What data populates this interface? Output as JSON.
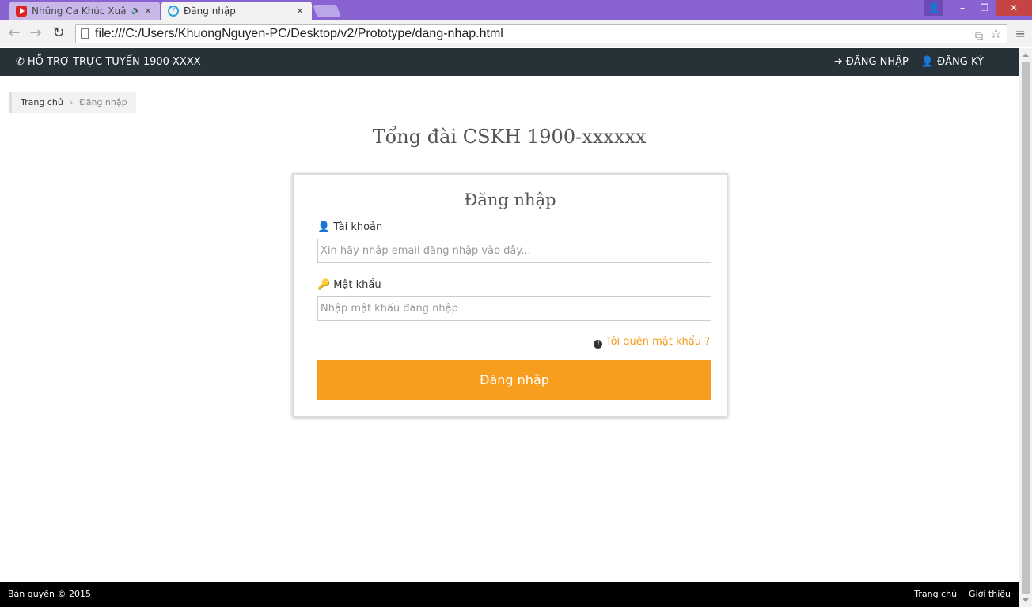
{
  "browser": {
    "tabs": [
      {
        "title": "Những Ca Khúc Xuân -",
        "icon": "youtube-icon",
        "active": false
      },
      {
        "title": "Đăng nhập",
        "icon": "site-icon",
        "active": true
      }
    ],
    "url": "file:///C:/Users/KhuongNguyen-PC/Desktop/v2/Prototype/dang-nhap.html"
  },
  "topnav": {
    "hotline": "HỖ TRỢ TRỰC TUYẾN 1900-XXXX",
    "login": "ĐĂNG NHẬP",
    "register": "ĐĂNG KÝ"
  },
  "breadcrumb": {
    "home": "Trang chủ",
    "current": "Đăng nhập"
  },
  "main": {
    "hotline_title": "Tổng đài CSKH 1900-xxxxxx"
  },
  "login_form": {
    "title": "Đăng nhập",
    "username_label": "Tài khoản",
    "username_placeholder": "Xin hãy nhập email đăng nhập vào đây...",
    "password_label": "Mật khẩu",
    "password_placeholder": "Nhập mật khẩu đăng nhập",
    "forgot": "Tôi quên mật khẩu ?",
    "submit": "Đăng nhập"
  },
  "footer": {
    "copyright": "Bản quyền © 2015",
    "links": [
      "Trang chủ",
      "Giới thiệu"
    ]
  },
  "colors": {
    "accent": "#f79e1e",
    "topnav_bg": "#263238",
    "footer_bg": "#000000",
    "titlebar": "#8a63d2"
  }
}
